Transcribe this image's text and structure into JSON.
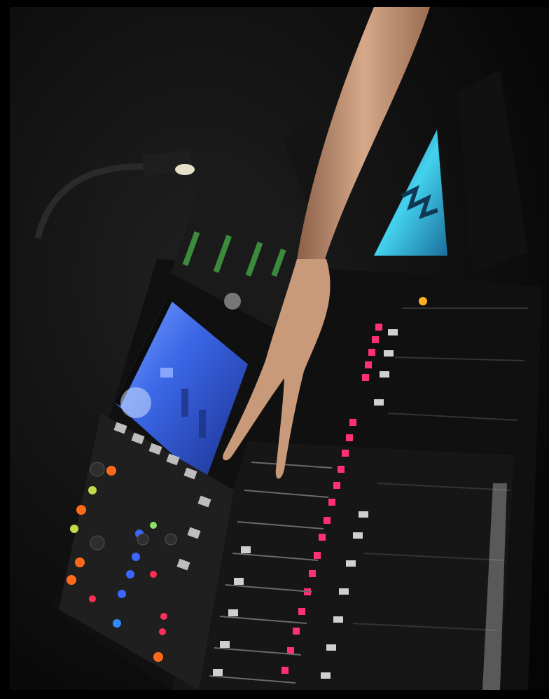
{
  "scene": {
    "subject": "mixing-console-photo",
    "colors": {
      "background": "#0b0b0b",
      "screen_blue": "#2f5fd6",
      "monitor_cyan": "#35c7e6",
      "led_pink": "#ff2f78",
      "led_orange": "#ff6a1a",
      "led_blue": "#2f6bff",
      "skin": "#c99a7a"
    }
  }
}
